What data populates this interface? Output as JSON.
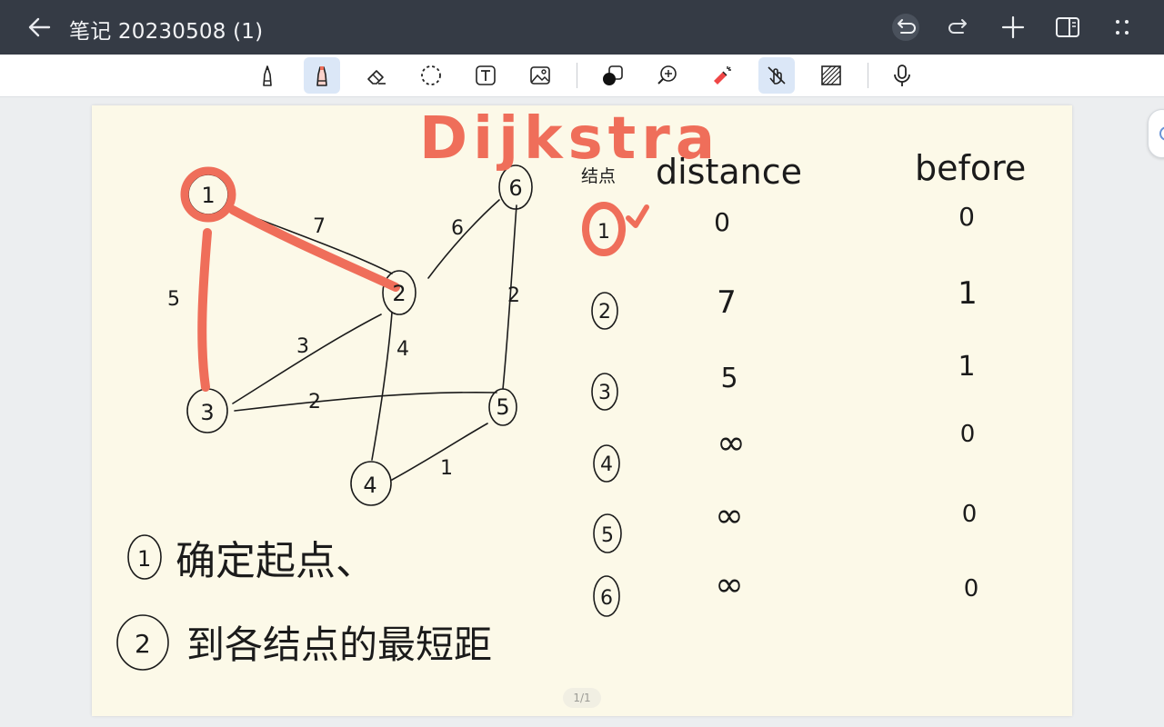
{
  "header": {
    "title": "笔记 20230508 (1)",
    "icons": [
      "back-arrow-icon",
      "undo-icon",
      "redo-icon",
      "add-icon",
      "side-panel-icon",
      "more-icon"
    ]
  },
  "toolbar": {
    "tools": [
      "pen",
      "marker",
      "eraser",
      "lasso",
      "text",
      "image",
      "color",
      "zoom",
      "laser-pointer",
      "finger-draw",
      "texture",
      "voice"
    ],
    "active": [
      "marker",
      "finger-draw"
    ],
    "active_color": "#dbe7f7"
  },
  "note": {
    "heading": "Dijkstra",
    "graph": {
      "nodes": [
        "1",
        "2",
        "3",
        "4",
        "5",
        "6"
      ],
      "edge_weights": [
        "7",
        "6",
        "5",
        "3",
        "4",
        "2",
        "2",
        "1"
      ]
    },
    "table": {
      "headers": [
        "结点",
        "distance",
        "before"
      ],
      "rows": [
        {
          "node": "1",
          "distance": "0",
          "before": "0"
        },
        {
          "node": "2",
          "distance": "7",
          "before": "1"
        },
        {
          "node": "3",
          "distance": "5",
          "before": "1"
        },
        {
          "node": "4",
          "distance": "∞",
          "before": "0"
        },
        {
          "node": "5",
          "distance": "∞",
          "before": "0"
        },
        {
          "node": "6",
          "distance": "∞",
          "before": "0"
        }
      ],
      "check_mark": "✓"
    },
    "steps": [
      {
        "num": "1",
        "text": "确定起点、"
      },
      {
        "num": "2",
        "text": "到各结点的最短距"
      }
    ],
    "highlight_color": "#ef6e5a",
    "ink_color": "#1b1b1b"
  },
  "page_indicator": "1/1"
}
